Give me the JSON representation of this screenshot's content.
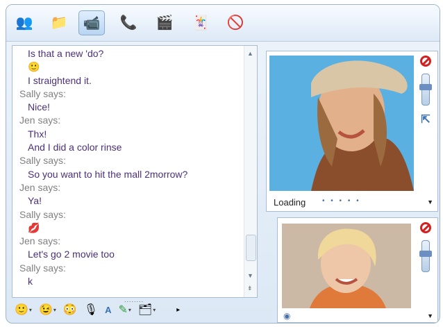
{
  "toolbar": {
    "buttons": [
      {
        "name": "invite-contact",
        "glyph": "👥"
      },
      {
        "name": "send-files",
        "glyph": "📁"
      },
      {
        "name": "video-call",
        "glyph": "📹"
      },
      {
        "name": "voice-call",
        "glyph": "📞"
      },
      {
        "name": "activities",
        "glyph": "🎬"
      },
      {
        "name": "games",
        "glyph": "🃏"
      },
      {
        "name": "block-contact",
        "glyph": "🚫"
      }
    ]
  },
  "chat": {
    "lines": [
      {
        "type": "msg",
        "text": "Is that a new 'do?"
      },
      {
        "type": "msg",
        "text": "🙂"
      },
      {
        "type": "msg",
        "text": "I straightend it."
      },
      {
        "type": "name",
        "text": "Sally says:"
      },
      {
        "type": "msg",
        "text": "Nice!"
      },
      {
        "type": "name",
        "text": "Jen says:"
      },
      {
        "type": "msg",
        "text": "Thx!"
      },
      {
        "type": "msg",
        "text": "And I did a color rinse"
      },
      {
        "type": "name",
        "text": "Sally says:"
      },
      {
        "type": "msg",
        "text": "So you want to hit the mall 2morrow?"
      },
      {
        "type": "name",
        "text": "Jen says:"
      },
      {
        "type": "msg",
        "text": "Ya!"
      },
      {
        "type": "name",
        "text": "Sally says:"
      },
      {
        "type": "msg",
        "text": "💋"
      },
      {
        "type": "name",
        "text": "Jen says:"
      },
      {
        "type": "msg",
        "text": "Let's go 2 movie too"
      },
      {
        "type": "name",
        "text": "Sally says:"
      },
      {
        "type": "msg",
        "text": "k"
      }
    ]
  },
  "bottom_bar": {
    "items": [
      {
        "name": "emoticon",
        "glyph": "🙂",
        "caret": "▾"
      },
      {
        "name": "wink",
        "glyph": "😉",
        "caret": "▾"
      },
      {
        "name": "nudge",
        "glyph": "😳",
        "caret": ""
      },
      {
        "name": "voice-clip",
        "glyph": "🎙",
        "caret": ""
      },
      {
        "name": "font",
        "glyph": "A",
        "caret": ""
      },
      {
        "name": "handwriting",
        "glyph": "✎",
        "caret": "▾"
      },
      {
        "name": "background",
        "glyph": "🗂",
        "caret": "▾"
      }
    ],
    "more": "▸",
    "grip": "........"
  },
  "webcam_remote": {
    "status": "Loading",
    "dots": "• • • • •"
  },
  "webcam_local": {
    "icon": "webcam-icon"
  },
  "colors": {
    "message_text": "#4b2f7a",
    "name_text": "#808080",
    "accent": "#3670b8"
  }
}
